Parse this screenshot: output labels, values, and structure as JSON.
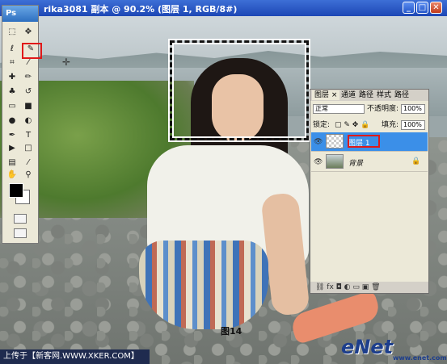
{
  "window": {
    "title": "rika3081 副本 @ 90.2% (图层 1, RGB/8#)",
    "buttons": {
      "minimize": "_",
      "restore": "□",
      "close": "✕"
    }
  },
  "toolbox": {
    "logo": "Ps",
    "tools": [
      "marquee-tool",
      "move-tool",
      "lasso-tool",
      "magic-wand-tool",
      "crop-tool",
      "slice-tool",
      "healing-brush-tool",
      "brush-tool",
      "clone-stamp-tool",
      "history-brush-tool",
      "eraser-tool",
      "gradient-tool",
      "blur-tool",
      "dodge-tool",
      "pen-tool",
      "type-tool",
      "path-selection-tool",
      "shape-tool",
      "notes-tool",
      "eyedropper-tool",
      "hand-tool",
      "zoom-tool"
    ],
    "glyphs": {
      "marquee": "⬚",
      "move": "✥",
      "lasso": "ℓ",
      "wand": "✎",
      "crop": "⌗",
      "slice": "⁄",
      "heal": "✚",
      "brush": "✏",
      "stamp": "♣",
      "history": "↺",
      "eraser": "▭",
      "gradient": "■",
      "blur": "●",
      "dodge": "◐",
      "pen": "✒",
      "type": "T",
      "path": "▶",
      "shape": "□",
      "notes": "▤",
      "eyedrop": "⁄",
      "hand": "✋",
      "zoom": "⚲"
    }
  },
  "layers_panel": {
    "tabs": [
      "图层 ×",
      "通道",
      "路径",
      "样式",
      "路径"
    ],
    "blend_mode": "正常",
    "opacity_label": "不透明度:",
    "opacity_value": "100%",
    "lock_label": "锁定:",
    "fill_label": "填充:",
    "fill_value": "100%",
    "layers": [
      {
        "name": "图层 1",
        "selected": true
      },
      {
        "name": "背景",
        "selected": false
      }
    ],
    "bottom_icons": "⛓ fx ◘ ◐ ▭ ▣ 🗑"
  },
  "caption": "图14",
  "footer": "上传于【新客网.WWW.XKER.COM】",
  "watermark": {
    "brand": "eNet",
    "url": "www.enet.com.cn"
  },
  "colors": {
    "titlebar": "#2456c4",
    "selection_highlight": "#e01919",
    "selected_layer": "#3b8fe8"
  }
}
